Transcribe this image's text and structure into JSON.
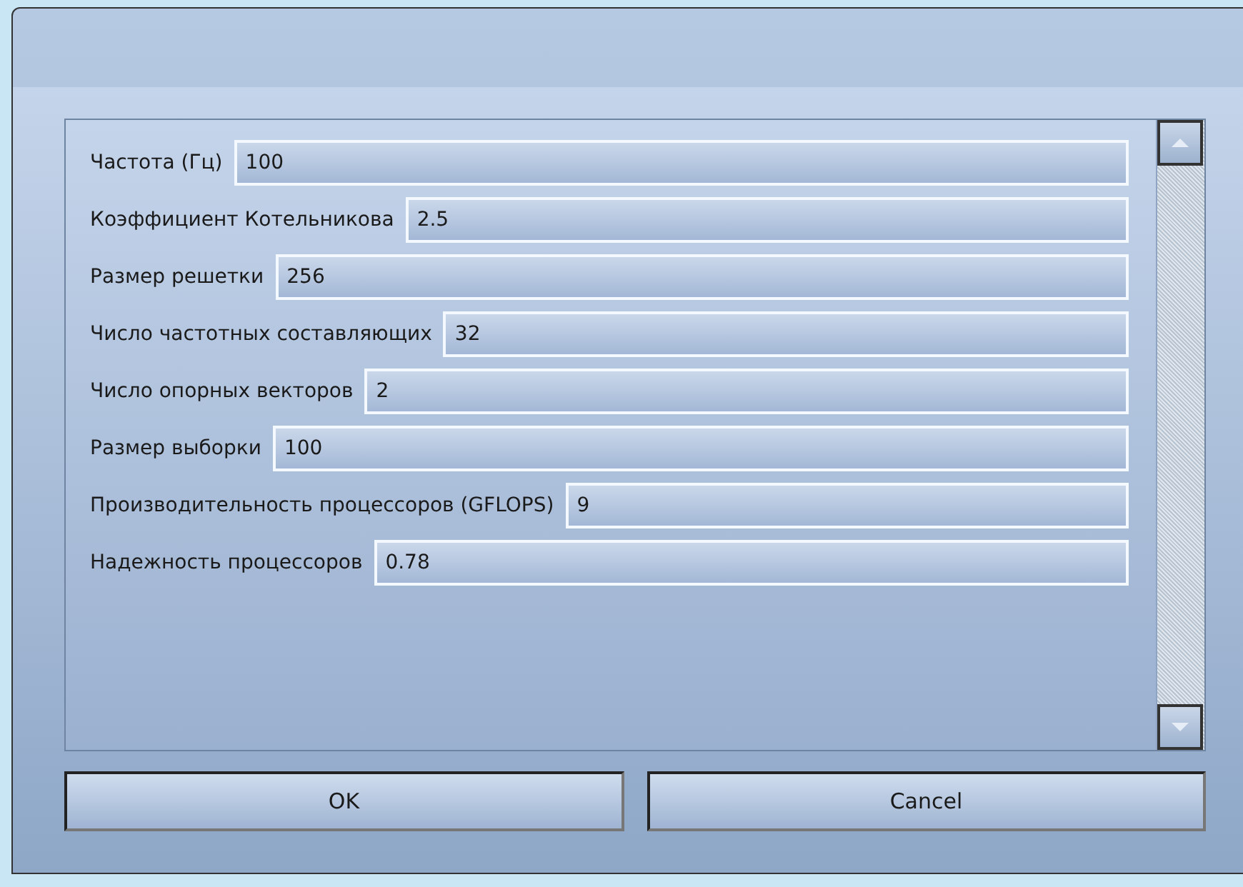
{
  "fields": [
    {
      "label": "Частота (Гц)",
      "value": "100"
    },
    {
      "label": "Коэффициент Котельникова",
      "value": "2.5"
    },
    {
      "label": "Размер решетки",
      "value": "256"
    },
    {
      "label": "Число частотных составляющих",
      "value": "32"
    },
    {
      "label": "Число опорных векторов",
      "value": "2"
    },
    {
      "label": "Размер выборки",
      "value": "100"
    },
    {
      "label": "Производительность процессоров (GFLOPS)",
      "value": "9"
    },
    {
      "label": "Надежность процессоров",
      "value": "0.78"
    }
  ],
  "buttons": [
    "OK",
    "Cancel"
  ]
}
